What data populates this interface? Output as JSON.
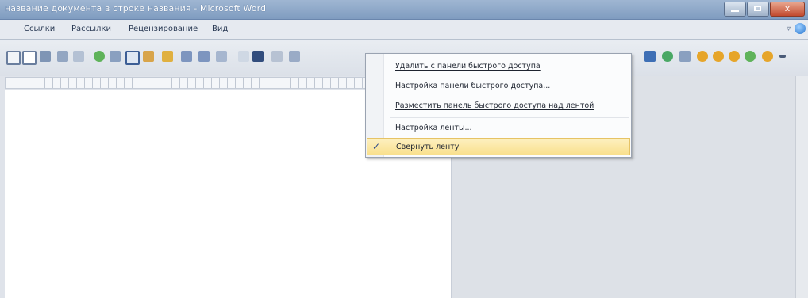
{
  "window": {
    "title": "название документа в строке названия - Microsoft Word",
    "minimize_glyph": "",
    "close_glyph": "x"
  },
  "ribbon": {
    "tabs": [
      "Ссылки",
      "Рассылки",
      "Рецензирование",
      "Вид"
    ],
    "collapse_glyph": "▿"
  },
  "context_menu": {
    "items": [
      {
        "label": "Удалить с панели быстрого доступа",
        "checked": false,
        "highlighted": false
      },
      {
        "label": "Настройка панели быстрого доступа...",
        "checked": false,
        "highlighted": false
      },
      {
        "label": "Разместить панель быстрого доступа над лентой",
        "checked": false,
        "highlighted": false
      },
      {
        "label": "Настройка ленты...",
        "checked": false,
        "highlighted": false
      },
      {
        "label": "Свернуть ленту",
        "checked": true,
        "highlighted": true
      }
    ],
    "check_glyph": "✓"
  },
  "colors": {
    "titlebar": "#8aa6c8",
    "menu_highlight": "#f9e08d",
    "close_button": "#c24a2e"
  }
}
